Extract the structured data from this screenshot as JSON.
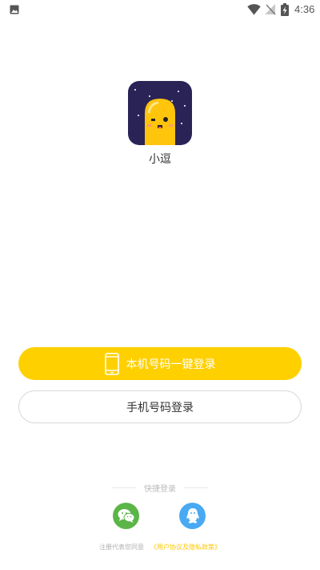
{
  "status_bar": {
    "time": "4:36",
    "icons": [
      "gallery-icon",
      "wifi-icon",
      "signal-icon",
      "battery-charging-icon"
    ]
  },
  "app": {
    "name": "小逗",
    "logo_icon": "smiling-bean-logo"
  },
  "buttons": {
    "one_click_login": "本机号码一键登录",
    "phone_login": "手机号码登录"
  },
  "quick_login": {
    "label": "快捷登录",
    "options": [
      "wechat-icon",
      "qq-icon"
    ]
  },
  "agreement": {
    "text": "注册代表您同意",
    "link": "《用户协议及隐私政策》"
  },
  "colors": {
    "primary": "#ffd000",
    "wechat": "#5bb548",
    "qq": "#49a9f2",
    "link": "#ffc800",
    "logo_background": "#2a2356"
  }
}
